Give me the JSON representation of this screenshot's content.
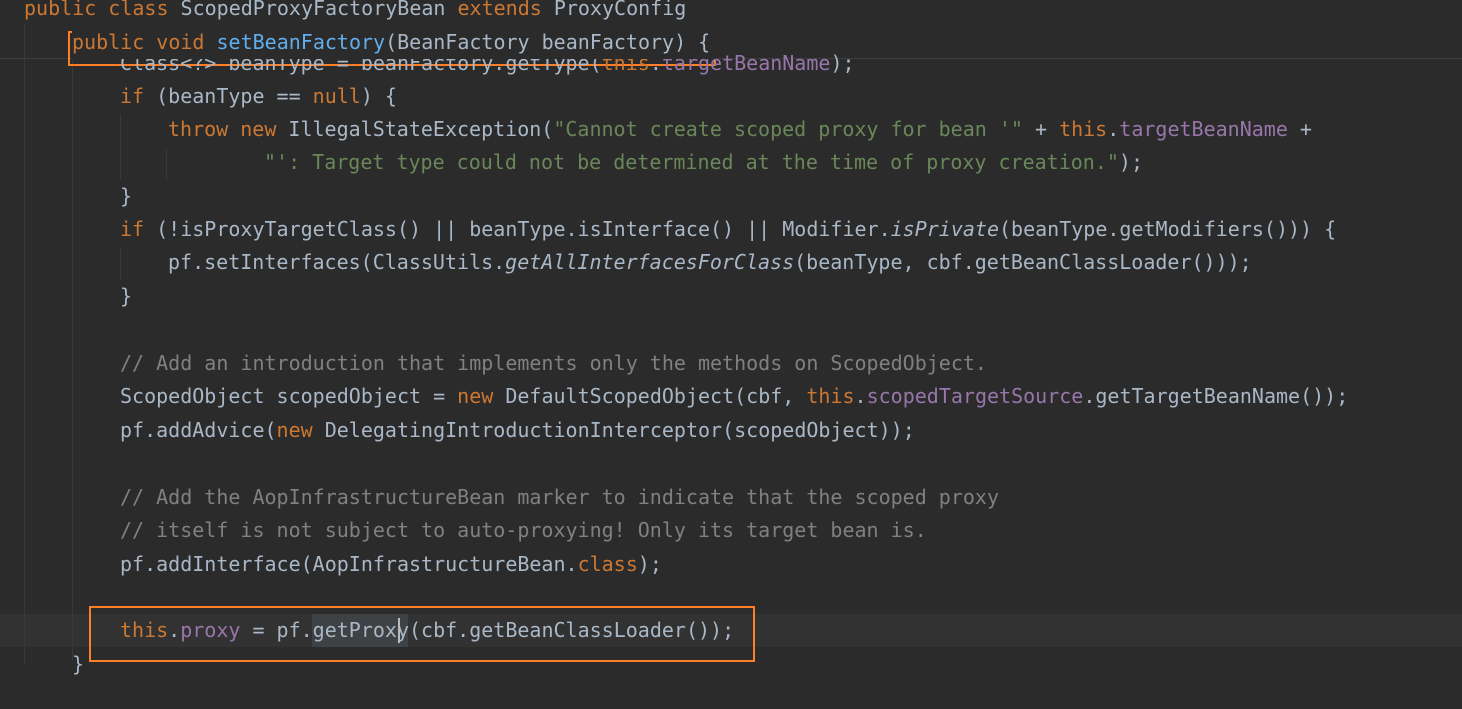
{
  "colors": {
    "background": "#2b2b2b",
    "default_text": "#a9b7c6",
    "keyword": "#cc7832",
    "method_declaration": "#61aeee",
    "string": "#6a8759",
    "field": "#9876aa",
    "comment": "#808080",
    "annotation_box": "#ff7f27"
  },
  "editor": {
    "lines": [
      {
        "id": "class-declaration",
        "tokens": [
          {
            "t": "public class ",
            "s": "kw"
          },
          {
            "t": "ScopedProxyFactoryBean ",
            "s": ""
          },
          {
            "t": "extends ",
            "s": "kw"
          },
          {
            "t": "ProxyConfig",
            "s": ""
          }
        ]
      },
      {
        "id": "partially-hidden-line",
        "tokens": [
          {
            "t": "Class<?> beanType = beanFactory.getType(",
            "s": ""
          },
          {
            "t": "this",
            "s": "kw"
          },
          {
            "t": ".",
            "s": ""
          },
          {
            "t": "targetBeanName",
            "s": "fld"
          },
          {
            "t": ");",
            "s": ""
          }
        ]
      },
      {
        "id": "method-declaration",
        "tokens": [
          {
            "t": "public void ",
            "s": "kw"
          },
          {
            "t": "setBeanFactory",
            "s": "fn"
          },
          {
            "t": "(BeanFactory beanFactory) {",
            "s": ""
          }
        ]
      },
      {
        "id": "if-beantype-null",
        "tokens": [
          {
            "t": "if ",
            "s": "kw"
          },
          {
            "t": "(beanType == ",
            "s": ""
          },
          {
            "t": "null",
            "s": "kw"
          },
          {
            "t": ") {",
            "s": ""
          }
        ]
      },
      {
        "id": "throw-statement",
        "tokens": [
          {
            "t": "throw new ",
            "s": "kw"
          },
          {
            "t": "IllegalStateException(",
            "s": ""
          },
          {
            "t": "\"Cannot create scoped proxy for bean '\"",
            "s": "str"
          },
          {
            "t": " + ",
            "s": ""
          },
          {
            "t": "this",
            "s": "kw"
          },
          {
            "t": ".",
            "s": ""
          },
          {
            "t": "targetBeanName",
            "s": "fld"
          },
          {
            "t": " +",
            "s": ""
          }
        ]
      },
      {
        "id": "throw-continuation",
        "tokens": [
          {
            "t": "\"': Target type could not be determined at the time of proxy creation.\"",
            "s": "str"
          },
          {
            "t": ");",
            "s": ""
          }
        ]
      },
      {
        "id": "close-if-1",
        "tokens": [
          {
            "t": "}",
            "s": ""
          }
        ]
      },
      {
        "id": "if-proxy-target-class",
        "tokens": [
          {
            "t": "if ",
            "s": "kw"
          },
          {
            "t": "(!isProxyTargetClass() || beanType.isInterface() || Modifier.",
            "s": ""
          },
          {
            "t": "isPrivate",
            "s": "ital"
          },
          {
            "t": "(beanType.getModifiers())) {",
            "s": ""
          }
        ]
      },
      {
        "id": "set-interfaces",
        "tokens": [
          {
            "t": "pf.setInterfaces(ClassUtils.",
            "s": ""
          },
          {
            "t": "getAllInterfacesForClass",
            "s": "ital"
          },
          {
            "t": "(beanType, cbf.getBeanClassLoader()));",
            "s": ""
          }
        ]
      },
      {
        "id": "close-if-2",
        "tokens": [
          {
            "t": "}",
            "s": ""
          }
        ]
      },
      {
        "id": "comment-introduction",
        "tokens": [
          {
            "t": "// Add an introduction that implements only the methods on ScopedObject.",
            "s": "cmt"
          }
        ]
      },
      {
        "id": "scoped-object-decl",
        "tokens": [
          {
            "t": "ScopedObject scopedObject = ",
            "s": ""
          },
          {
            "t": "new ",
            "s": "kw"
          },
          {
            "t": "DefaultScopedObject(cbf, ",
            "s": ""
          },
          {
            "t": "this",
            "s": "kw"
          },
          {
            "t": ".",
            "s": ""
          },
          {
            "t": "scopedTargetSource",
            "s": "fld"
          },
          {
            "t": ".getTargetBeanName());",
            "s": ""
          }
        ]
      },
      {
        "id": "add-advice",
        "tokens": [
          {
            "t": "pf.addAdvice(",
            "s": ""
          },
          {
            "t": "new ",
            "s": "kw"
          },
          {
            "t": "DelegatingIntroductionInterceptor(scopedObject));",
            "s": ""
          }
        ]
      },
      {
        "id": "comment-marker-1",
        "tokens": [
          {
            "t": "// Add the AopInfrastructureBean marker to indicate that the scoped proxy",
            "s": "cmt"
          }
        ]
      },
      {
        "id": "comment-marker-2",
        "tokens": [
          {
            "t": "// itself is not subject to auto-proxying! Only its target bean is.",
            "s": "cmt"
          }
        ]
      },
      {
        "id": "add-interface",
        "tokens": [
          {
            "t": "pf.addInterface(AopInfrastructureBean.",
            "s": ""
          },
          {
            "t": "class",
            "s": "kw"
          },
          {
            "t": ");",
            "s": ""
          }
        ]
      },
      {
        "id": "proxy-assignment",
        "tokens": [
          {
            "t": "this",
            "s": "kw"
          },
          {
            "t": ".",
            "s": ""
          },
          {
            "t": "proxy",
            "s": "fld"
          },
          {
            "t": " = pf.getProxy(cbf.getBeanClassLoader());",
            "s": ""
          }
        ]
      },
      {
        "id": "close-method",
        "tokens": [
          {
            "t": "}",
            "s": ""
          }
        ]
      }
    ]
  }
}
